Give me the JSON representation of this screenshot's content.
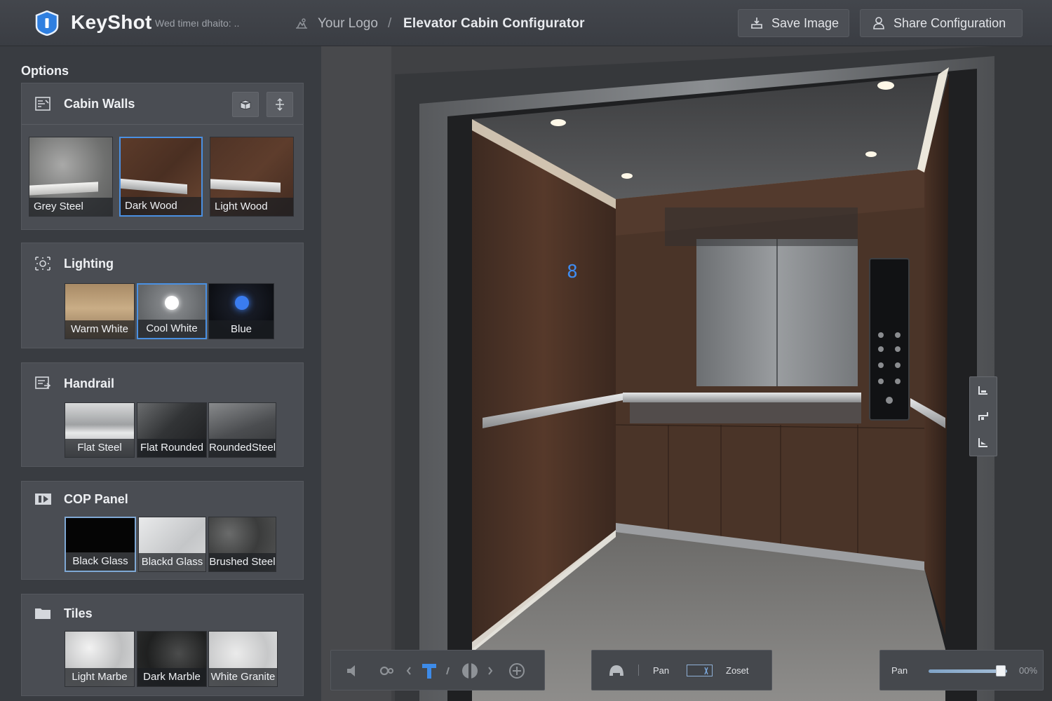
{
  "app": {
    "brand": "KeyShot",
    "brand_sub": "Wed timeı dhaito: ..",
    "accent_color": "#4a90e2"
  },
  "breadcrumb": {
    "logo_text": "Your Logo",
    "separator": "/",
    "page_title": "Elevator Cabin Configurator"
  },
  "toolbar": {
    "save_label": "Save Image",
    "share_label": "Share Configuration"
  },
  "sidebar": {
    "title": "Options",
    "sections": [
      {
        "title": "Cabin Walls",
        "icon": "walls-icon",
        "options": [
          {
            "label": "Grey Steel",
            "selected": false
          },
          {
            "label": "Dark Wood",
            "selected": true
          },
          {
            "label": "Light Wood",
            "selected": false
          }
        ]
      },
      {
        "title": "Lighting",
        "icon": "lighting-icon",
        "options": [
          {
            "label": "Warm White",
            "selected": false
          },
          {
            "label": "Cool White",
            "selected": true
          },
          {
            "label": "Blue",
            "selected": false
          }
        ]
      },
      {
        "title": "Handrail",
        "icon": "handrail-icon",
        "options": [
          {
            "label": "Flat Steel",
            "selected": false
          },
          {
            "label": "Flat Rounded",
            "selected": false
          },
          {
            "label": "RoundedSteel",
            "selected": false
          }
        ]
      },
      {
        "title": "COP Panel",
        "icon": "cop-panel-icon",
        "options": [
          {
            "label": "Black Glass",
            "selected": true
          },
          {
            "label": "Blackd Glass",
            "selected": false
          },
          {
            "label": "Brushed Steel",
            "selected": false
          }
        ]
      },
      {
        "title": "Tiles",
        "icon": "folder-icon",
        "options": [
          {
            "label": "Light Marbe",
            "selected": false
          },
          {
            "label": "Dark Marble",
            "selected": false
          },
          {
            "label": "White Granite",
            "selected": false
          }
        ]
      }
    ]
  },
  "viewport": {
    "floor_display": "8"
  },
  "bottom_bar": {
    "pan_label": "Pan",
    "zoom_label": "Zoset",
    "right_pan_label": "Pan",
    "zoom_value": "00%",
    "zoom_level": 0.92
  }
}
